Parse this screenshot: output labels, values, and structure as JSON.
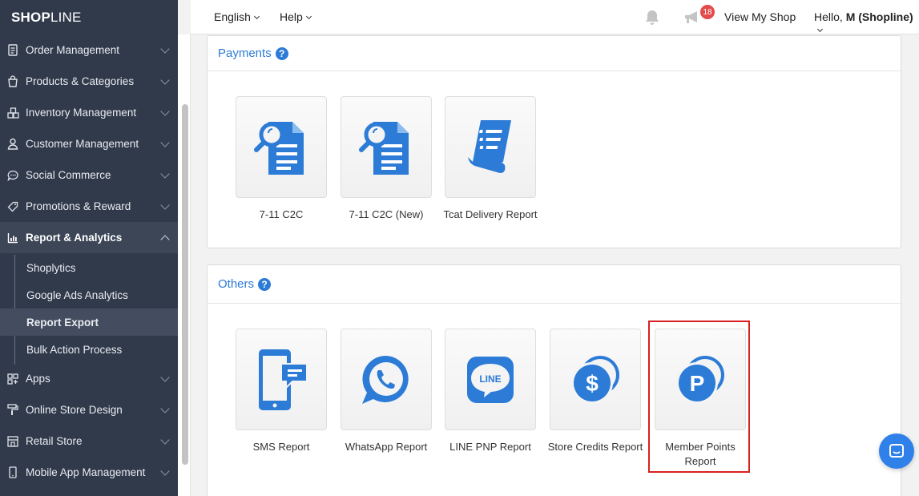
{
  "brand": {
    "logo_bold": "SHOP",
    "logo_thin": "LINE"
  },
  "topbar": {
    "language": "English",
    "help": "Help",
    "notification_count": "18",
    "view_shop": "View My Shop",
    "greeting": "Hello, ",
    "user_name": "M (Shopline)"
  },
  "sidebar": {
    "items": [
      {
        "label": "Order Management",
        "icon": "clipboard-icon"
      },
      {
        "label": "Products & Categories",
        "icon": "shopping-bag-icon"
      },
      {
        "label": "Inventory Management",
        "icon": "boxes-icon"
      },
      {
        "label": "Customer Management",
        "icon": "user-icon"
      },
      {
        "label": "Social Commerce",
        "icon": "chat-bubble-icon"
      },
      {
        "label": "Promotions & Reward",
        "icon": "tag-icon"
      },
      {
        "label": "Report & Analytics",
        "icon": "chart-icon"
      },
      {
        "label": "Apps",
        "icon": "apps-icon"
      },
      {
        "label": "Online Store Design",
        "icon": "paint-roller-icon"
      },
      {
        "label": "Retail Store",
        "icon": "store-icon"
      },
      {
        "label": "Mobile App Management",
        "icon": "mobile-icon"
      }
    ],
    "sub_items": [
      {
        "label": "Shoplytics"
      },
      {
        "label": "Google Ads Analytics"
      },
      {
        "label": "Report Export"
      },
      {
        "label": "Bulk Action Process"
      }
    ]
  },
  "payments": {
    "title": "Payments",
    "cards": [
      {
        "label": "7-11 C2C",
        "icon": "document-search-icon"
      },
      {
        "label": "7-11 C2C (New)",
        "icon": "document-search-icon"
      },
      {
        "label": "Tcat Delivery Report",
        "icon": "receipt-icon"
      }
    ]
  },
  "others": {
    "title": "Others",
    "cards": [
      {
        "label": "SMS Report",
        "icon": "phone-message-icon"
      },
      {
        "label": "WhatsApp Report",
        "icon": "whatsapp-icon"
      },
      {
        "label": "LINE PNP Report",
        "icon": "line-icon"
      },
      {
        "label": "Store Credits Report",
        "icon": "coins-dollar-icon"
      },
      {
        "label": "Member Points Report",
        "icon": "points-icon"
      }
    ]
  },
  "colors": {
    "sidebar": "#313a4b",
    "accent": "#2c7bd6",
    "highlight": "#d82020"
  }
}
